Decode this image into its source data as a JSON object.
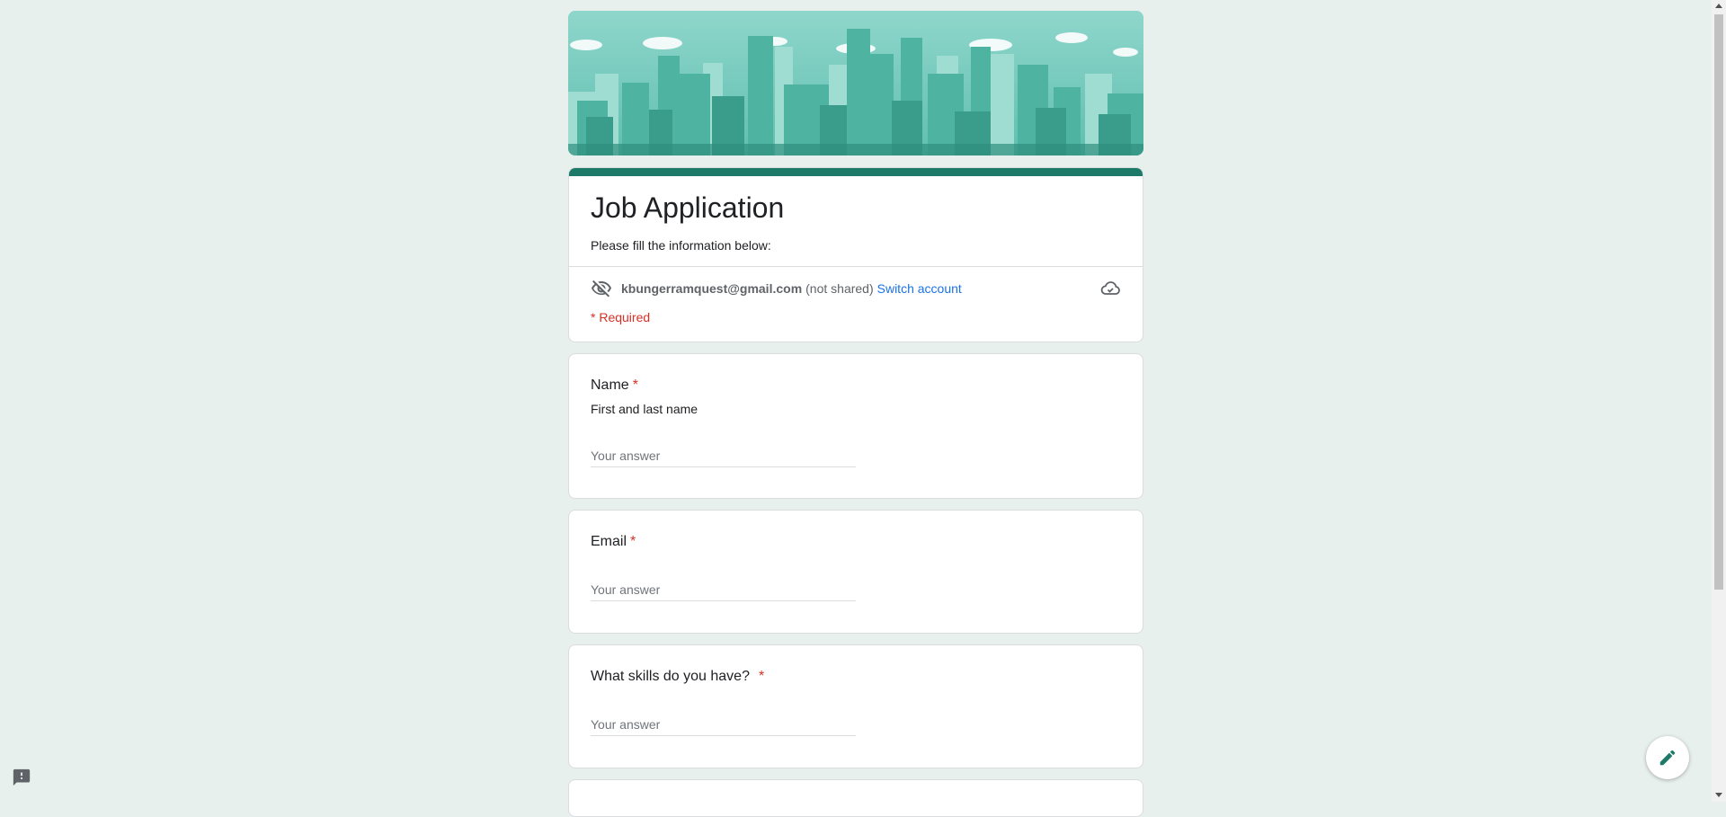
{
  "form": {
    "title": "Job Application",
    "description": "Please fill the information below:",
    "account_email": "kbungerramquest@gmail.com",
    "not_shared": "(not shared)",
    "switch_account": "Switch account",
    "required_note": "* Required"
  },
  "questions": [
    {
      "title": "Name",
      "star": "*",
      "description": "First and last name",
      "placeholder": "Your answer",
      "value": ""
    },
    {
      "title": "Email",
      "star": "*",
      "placeholder": "Your answer",
      "value": ""
    },
    {
      "title": "What skills do you have?",
      "star": "*",
      "placeholder": "Your answer",
      "value": ""
    }
  ],
  "icons": {
    "eye_off": "eye-off-icon",
    "cloud": "cloud-icon",
    "edit": "pencil-icon",
    "report": "report-icon"
  },
  "colors": {
    "theme": "#1d7a68",
    "background": "#e8f0ed",
    "required": "#d93025",
    "link": "#1a73e8"
  }
}
